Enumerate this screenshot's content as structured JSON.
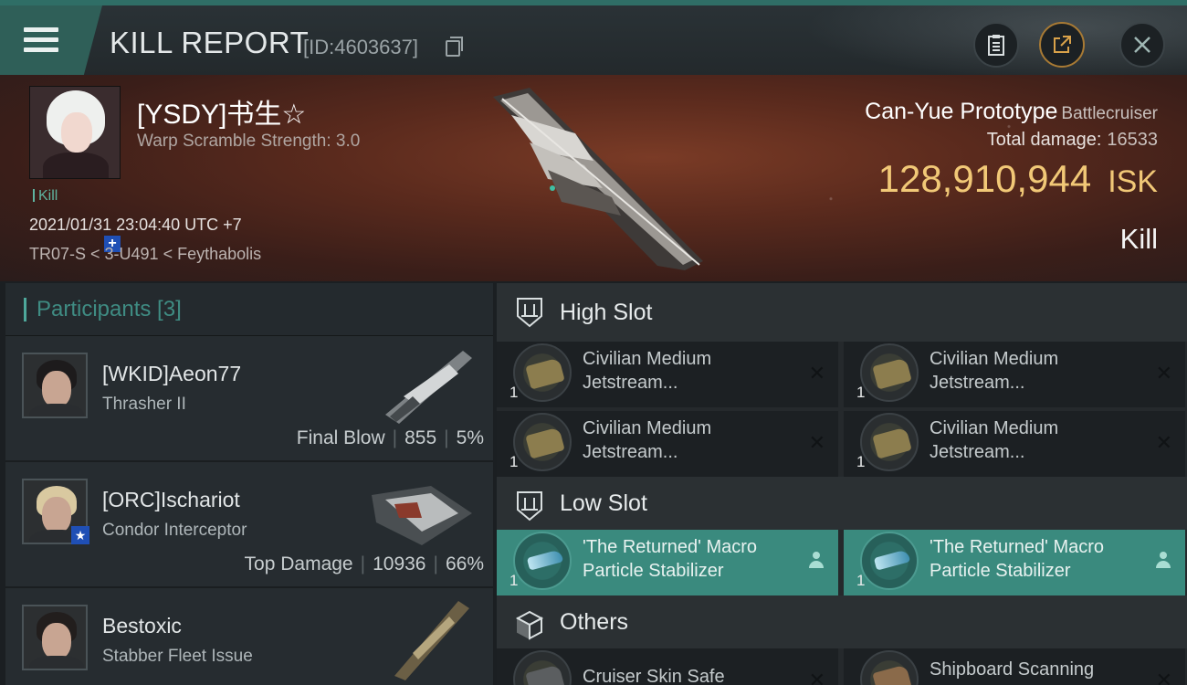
{
  "header": {
    "title": "KILL REPORT",
    "report_id": "[ID:4603637]"
  },
  "victim": {
    "name": "[YSDY]书生☆",
    "scramble": "Warp Scramble Strength: 3.0",
    "tag": "Kill",
    "datetime": "2021/01/31 23:04:40 UTC +7",
    "location": "TR07-S < 3-U491 < Feythabolis",
    "ship_name": "Can-Yue Prototype",
    "ship_class": "Battlecruiser",
    "total_damage_label": "Total damage:",
    "total_damage": "16533",
    "isk_value": "128,910,944",
    "isk_unit": "ISK",
    "result": "Kill"
  },
  "participants": {
    "title": "Participants [3]",
    "rows": [
      {
        "name": "[WKID]Aeon77",
        "ship": "Thrasher II",
        "stat_label": "Final Blow",
        "damage": "855",
        "percent": "5%"
      },
      {
        "name": "[ORC]Ischariot",
        "ship": "Condor Interceptor",
        "stat_label": "Top Damage",
        "damage": "10936",
        "percent": "66%"
      },
      {
        "name": "Bestoxic",
        "ship": "Stabber Fleet Issue"
      }
    ]
  },
  "fitting": {
    "high_slot": {
      "label": "High Slot",
      "items": [
        {
          "qty": "1",
          "name": "Civilian Medium Jetstream..."
        },
        {
          "qty": "1",
          "name": "Civilian Medium Jetstream..."
        },
        {
          "qty": "1",
          "name": "Civilian Medium Jetstream..."
        },
        {
          "qty": "1",
          "name": "Civilian Medium Jetstream..."
        }
      ]
    },
    "low_slot": {
      "label": "Low Slot",
      "items": [
        {
          "qty": "1",
          "name": "'The Returned' Macro Particle Stabilizer"
        },
        {
          "qty": "1",
          "name": "'The Returned' Macro Particle Stabilizer"
        }
      ]
    },
    "others": {
      "label": "Others",
      "items": [
        {
          "name": "Cruiser Skin Safe"
        },
        {
          "name": "Shipboard Scanning"
        }
      ]
    }
  },
  "colors": {
    "accent_teal": "#3a8a7e",
    "isk_gold": "#f1c877",
    "hero_red": "#5a2a1d"
  }
}
